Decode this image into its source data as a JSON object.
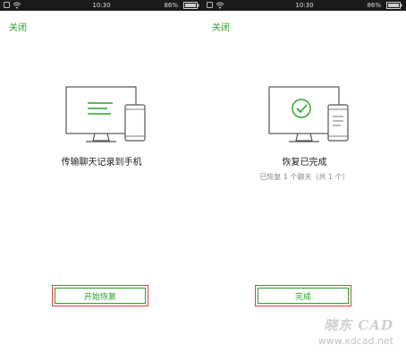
{
  "screens": [
    {
      "status": {
        "time": "10:30",
        "battery": "86%"
      },
      "close_label": "关闭",
      "title": "传输聊天记录到手机",
      "subtitle": "",
      "button_label": "开始恢复"
    },
    {
      "status": {
        "time": "10:30",
        "battery": "86%"
      },
      "close_label": "关闭",
      "title": "恢复已完成",
      "subtitle": "已恢复 1 个聊天（共 1 个）",
      "button_label": "完成"
    }
  ],
  "watermark": {
    "logo": "晓东 CAD",
    "url": "www.xdcad.net"
  },
  "colors": {
    "accent": "#2aa02a",
    "highlight_border": "#e04040",
    "status_bar": "#1a1a1a"
  }
}
